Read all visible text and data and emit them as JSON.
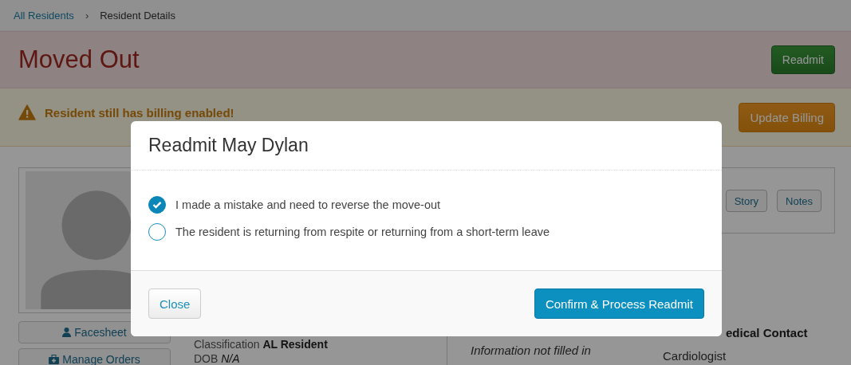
{
  "breadcrumb": [
    {
      "label": "All Residents",
      "kind": "link"
    },
    {
      "label": "›",
      "kind": "separator"
    },
    {
      "label": "Resident Details",
      "kind": "current"
    }
  ],
  "status_header": {
    "title": "Moved Out",
    "button": "Readmit"
  },
  "warning": {
    "message": "Resident still has billing enabled!",
    "button": "Update Billing"
  },
  "sidebar": {
    "buttons": [
      {
        "label": "Facesheet",
        "kind": "person"
      },
      {
        "label": "Manage Orders",
        "kind": "medkit"
      }
    ]
  },
  "details": {
    "classification_label": "Classification",
    "classification_value": "AL Resident",
    "dob_label": "DOB",
    "dob_value": "N/A"
  },
  "panel": {
    "buttons": [
      "Story",
      "Notes"
    ]
  },
  "info": {
    "placeholder_text": "Information not filled in",
    "contact_heading": "edical Contact",
    "contact_value": "Cardiologist"
  },
  "modal": {
    "title": "Readmit May Dylan",
    "options": [
      {
        "label": "I made a mistake and need to reverse the move-out",
        "selected": true
      },
      {
        "label": "The resident is returning from respite or returning from a short-term leave",
        "selected": false
      }
    ],
    "close_button": "Close",
    "confirm_button": "Confirm & Process Readmit"
  }
}
